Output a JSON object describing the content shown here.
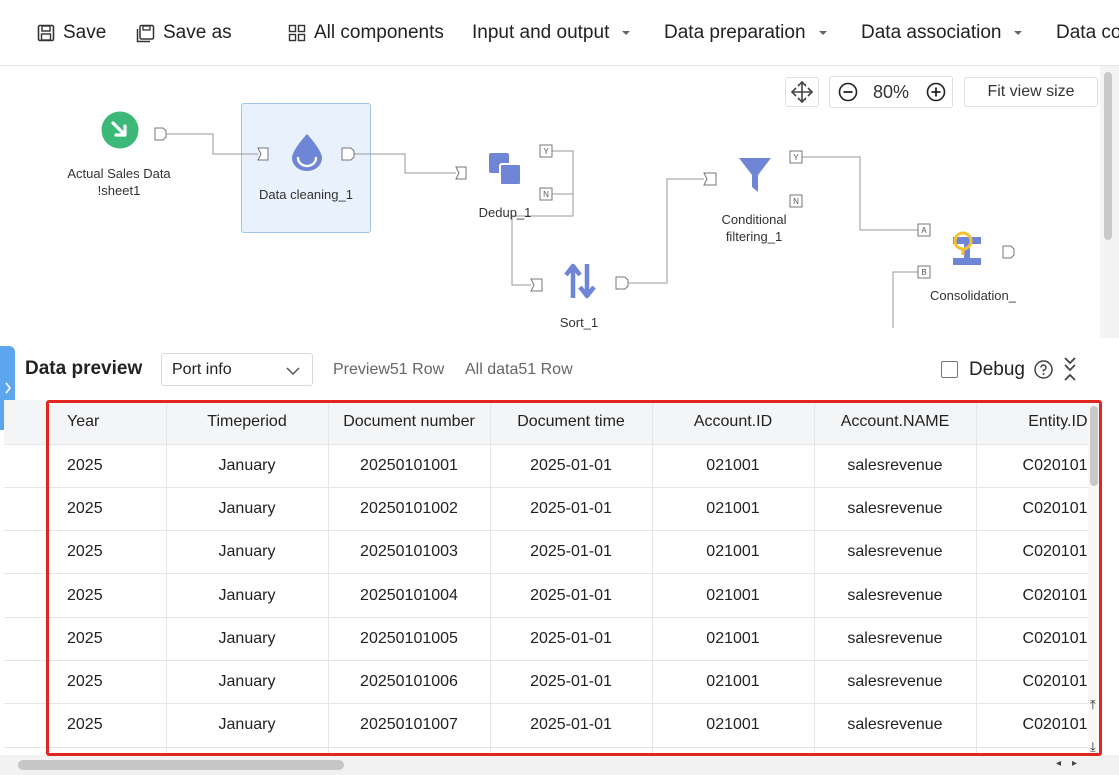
{
  "toolbar": {
    "save_label": "Save",
    "save_as_label": "Save as",
    "all_components_label": "All components",
    "menus": [
      {
        "label": "Input and output"
      },
      {
        "label": "Data preparation"
      },
      {
        "label": "Data association"
      },
      {
        "label": "Data co"
      }
    ]
  },
  "canvas": {
    "nodes": {
      "actual_sales": {
        "label_line1": "Actual Sales Data",
        "label_line2": "!sheet1"
      },
      "data_cleaning": {
        "label": "Data cleaning_1"
      },
      "dedup": {
        "label": "Dedup_1"
      },
      "sort": {
        "label": "Sort_1"
      },
      "cond_filter": {
        "label_line1": "Conditional",
        "label_line2": "filtering_1"
      },
      "consolidation": {
        "label": "Consolidation_"
      }
    },
    "port_labels": {
      "yes": "Y",
      "no": "N",
      "a": "A",
      "b": "B"
    },
    "zoom_level": "80%",
    "fit_view_label": "Fit view size"
  },
  "preview": {
    "title": "Data preview",
    "port_select_value": "Port info",
    "preview_rows_text": "Preview51 Row",
    "all_data_text": "All data51 Row",
    "debug_label": "Debug",
    "columns": [
      "Year",
      "Timeperiod",
      "Document number",
      "Document time",
      "Account.ID",
      "Account.NAME",
      "Entity.ID"
    ],
    "rows": [
      [
        "2025",
        "January",
        "20250101001",
        "2025-01-01",
        "021001",
        "salesrevenue",
        "C020101"
      ],
      [
        "2025",
        "January",
        "20250101002",
        "2025-01-01",
        "021001",
        "salesrevenue",
        "C020101"
      ],
      [
        "2025",
        "January",
        "20250101003",
        "2025-01-01",
        "021001",
        "salesrevenue",
        "C020101"
      ],
      [
        "2025",
        "January",
        "20250101004",
        "2025-01-01",
        "021001",
        "salesrevenue",
        "C020101"
      ],
      [
        "2025",
        "January",
        "20250101005",
        "2025-01-01",
        "021001",
        "salesrevenue",
        "C020101"
      ],
      [
        "2025",
        "January",
        "20250101006",
        "2025-01-01",
        "021001",
        "salesrevenue",
        "C020101"
      ],
      [
        "2025",
        "January",
        "20250101007",
        "2025-01-01",
        "021001",
        "salesrevenue",
        "C020101"
      ],
      [
        "",
        "",
        "",
        "",
        "",
        "",
        ""
      ]
    ]
  },
  "colors": {
    "accent": "#5ea5f0",
    "node_icon": "#6f86d6",
    "source_green": "#3cb878",
    "highlight_red": "#e0261f",
    "consolidation_yellow": "#f2c230"
  }
}
